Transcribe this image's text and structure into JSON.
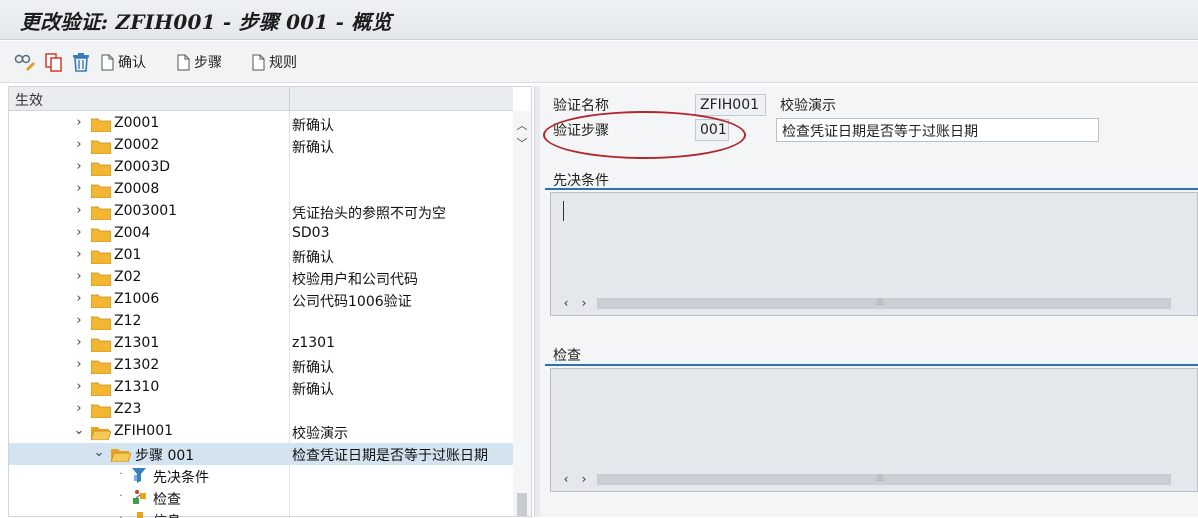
{
  "title": "更改验证: ZFIH001 - 步骤 001 - 概览",
  "toolbar": {
    "confirm": "确认",
    "step": "步骤",
    "rule": "规则"
  },
  "tree": {
    "header": "生效",
    "items": [
      {
        "name": "Z0001",
        "desc": "新确认"
      },
      {
        "name": "Z0002",
        "desc": "新确认"
      },
      {
        "name": "Z0003D",
        "desc": ""
      },
      {
        "name": "Z0008",
        "desc": ""
      },
      {
        "name": "Z003001",
        "desc": "凭证抬头的参照不可为空"
      },
      {
        "name": "Z004",
        "desc": "SD03"
      },
      {
        "name": "Z01",
        "desc": "新确认"
      },
      {
        "name": "Z02",
        "desc": "校验用户和公司代码"
      },
      {
        "name": "Z1006",
        "desc": "公司代码1006验证"
      },
      {
        "name": "Z12",
        "desc": ""
      },
      {
        "name": "Z1301",
        "desc": "z1301"
      },
      {
        "name": "Z1302",
        "desc": "新确认"
      },
      {
        "name": "Z1310",
        "desc": "新确认"
      },
      {
        "name": "Z23",
        "desc": ""
      },
      {
        "name": "ZFIH001",
        "desc": "校验演示"
      },
      {
        "name": "步骤 001",
        "desc": "检查凭证日期是否等于过账日期"
      },
      {
        "name": "先决条件",
        "desc": ""
      },
      {
        "name": "检查",
        "desc": ""
      },
      {
        "name": "信息",
        "desc": ""
      }
    ]
  },
  "detail": {
    "validation_label": "验证名称",
    "validation_value": "ZFIH001",
    "validation_text": "校验演示",
    "step_label": "验证步骤",
    "step_value": "001",
    "step_text": "检查凭证日期是否等于过账日期",
    "precondition_title": "先决条件",
    "check_title": "检查",
    "scroll_grip": "⦙⦙⦙"
  },
  "colors": {
    "selection": "#d3e3f0",
    "section_line": "#2c73b4",
    "annotation_circle": "#b0282b",
    "folder": "#f2b632"
  }
}
